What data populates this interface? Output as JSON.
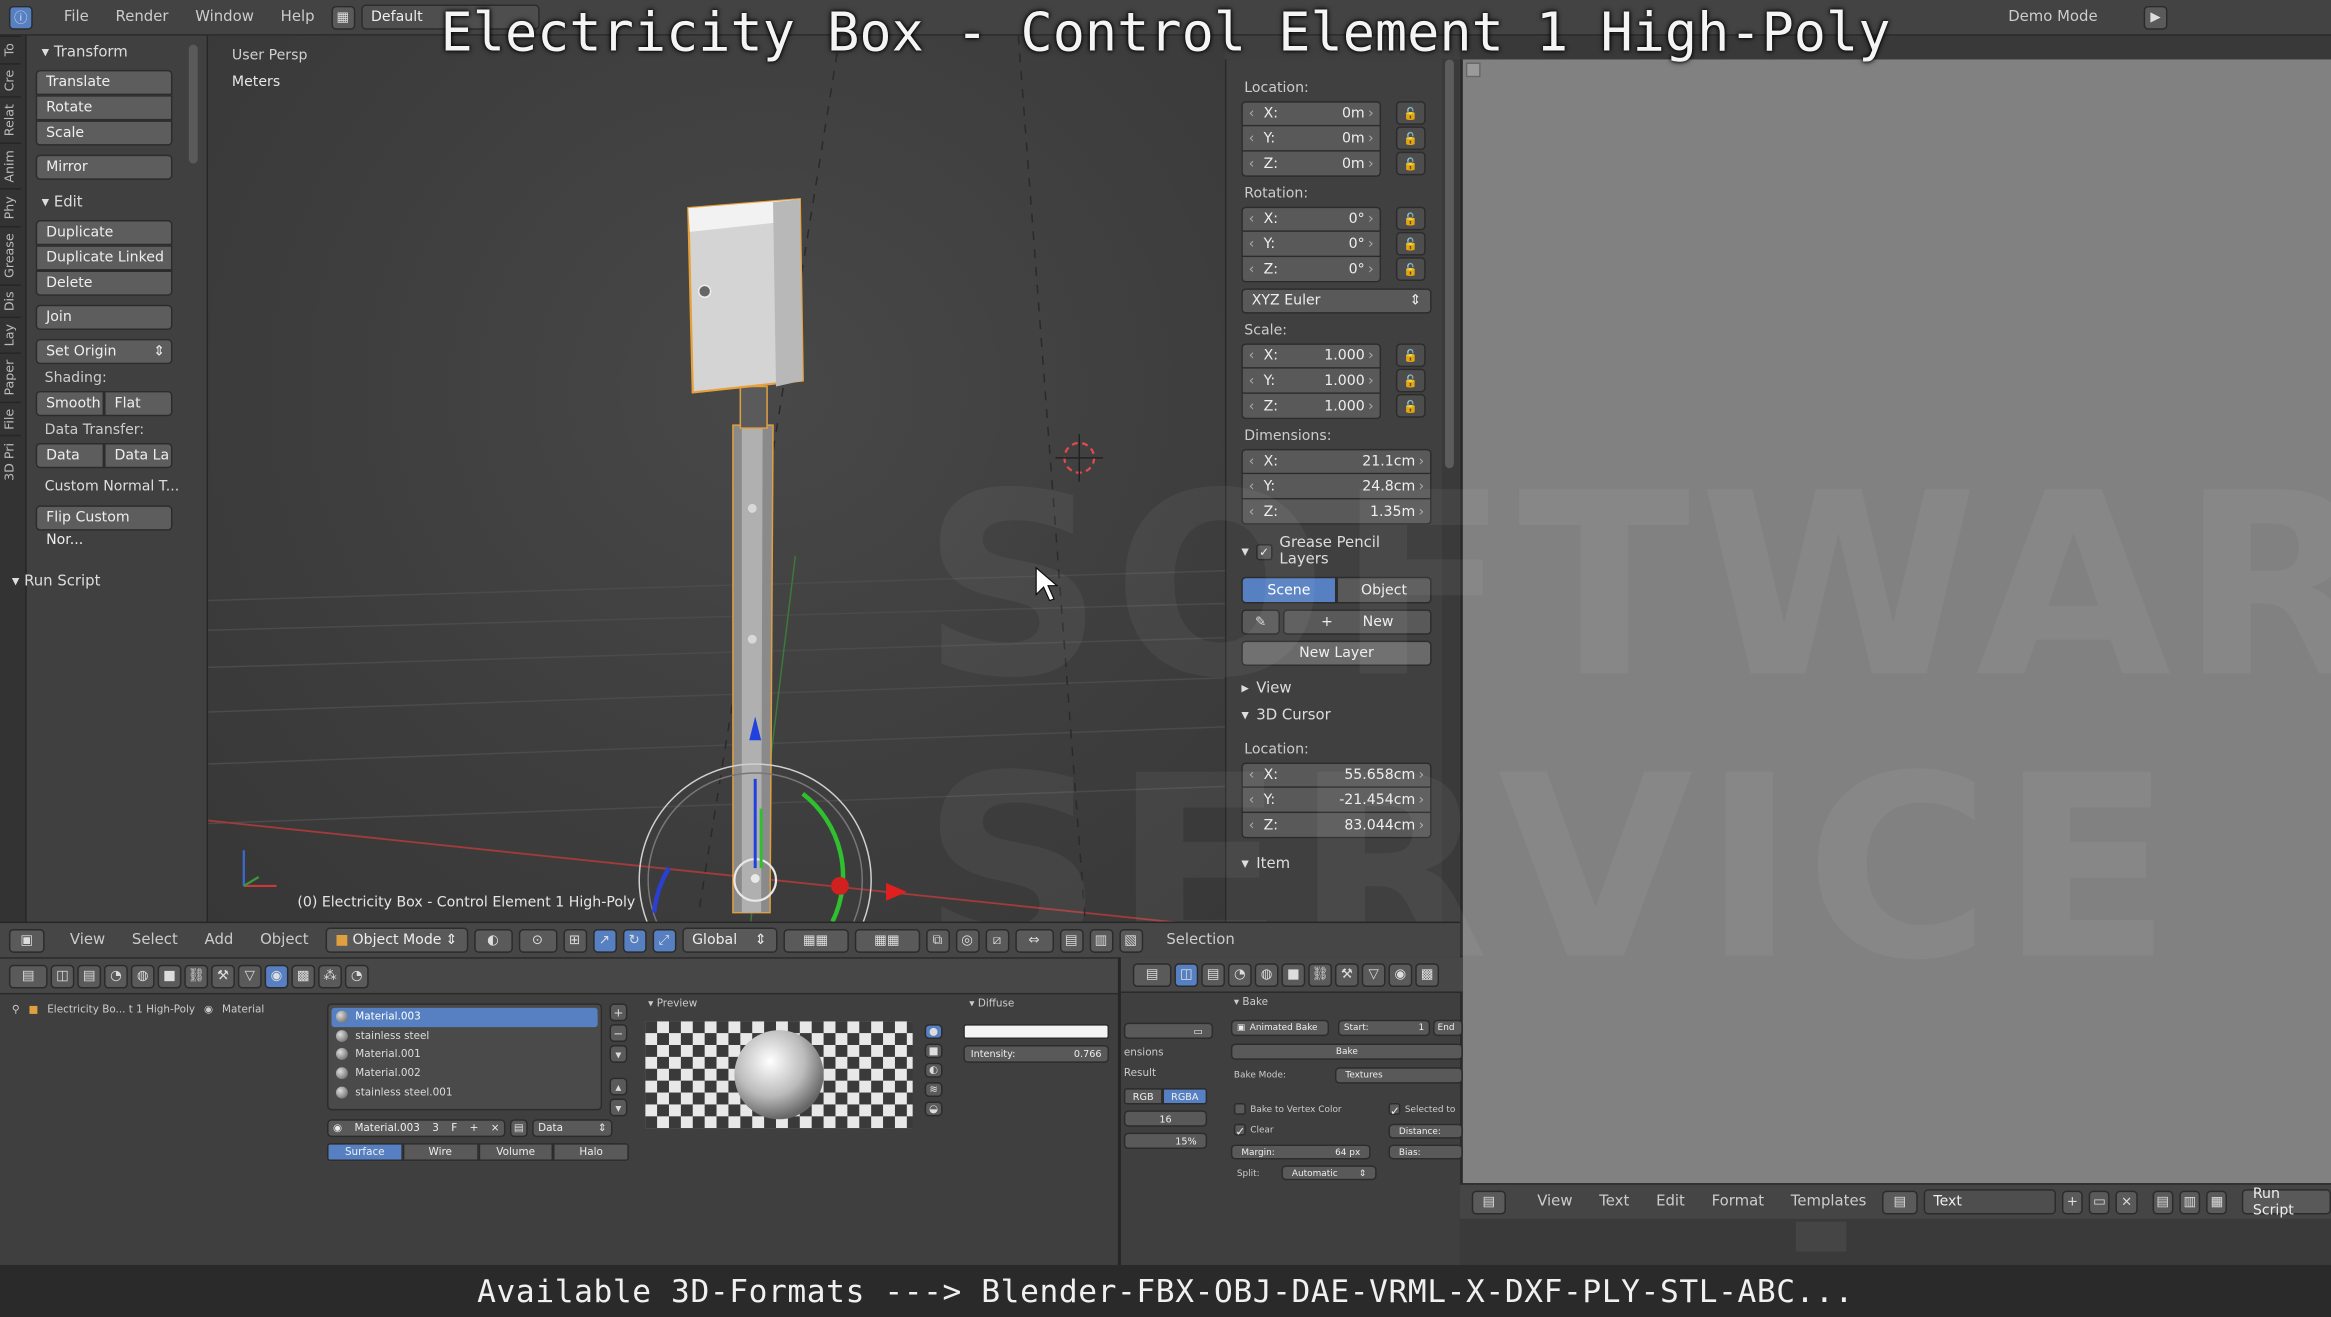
{
  "overlay": {
    "title": "Electricity Box - Control Element 1 High-Poly",
    "caption": "Available 3D-Formats ---> Blender-FBX-OBJ-DAE-VRML-X-DXF-PLY-STL-ABC..."
  },
  "info_header": {
    "menus": [
      "File",
      "Render",
      "Window",
      "Help"
    ],
    "layout": "Default",
    "demo": "Demo Mode"
  },
  "tool_tabs": [
    "To",
    "Cre",
    "Relat",
    "Anim",
    "Phy",
    "Grease",
    "Dis",
    "Lay",
    "Paper",
    "File",
    "3D Pri"
  ],
  "tool_shelf": {
    "transform_header": "Transform",
    "translate": "Translate",
    "rotate": "Rotate",
    "scale": "Scale",
    "mirror": "Mirror",
    "edit_header": "Edit",
    "duplicate": "Duplicate",
    "duplicate_linked": "Duplicate Linked",
    "delete": "Delete",
    "join": "Join",
    "set_origin": "Set Origin",
    "shading_label": "Shading:",
    "smooth": "Smooth",
    "flat": "Flat",
    "data_transfer_label": "Data Transfer:",
    "data": "Data",
    "data_la": "Data La",
    "custom_normal": "Custom Normal T...",
    "flip_custom": "Flip Custom Nor...",
    "run_script_header": "Run Script"
  },
  "viewport": {
    "view_name": "User Persp",
    "units": "Meters",
    "object_info": "(0) Electricity Box - Control Element 1 High-Poly"
  },
  "n_panel": {
    "location_label": "Location:",
    "location": [
      {
        "axis": "X:",
        "value": "0m"
      },
      {
        "axis": "Y:",
        "value": "0m"
      },
      {
        "axis": "Z:",
        "value": "0m"
      }
    ],
    "rotation_label": "Rotation:",
    "rotation": [
      {
        "axis": "X:",
        "value": "0°"
      },
      {
        "axis": "Y:",
        "value": "0°"
      },
      {
        "axis": "Z:",
        "value": "0°"
      }
    ],
    "rotation_mode": "XYZ Euler",
    "scale_label": "Scale:",
    "scale": [
      {
        "axis": "X:",
        "value": "1.000"
      },
      {
        "axis": "Y:",
        "value": "1.000"
      },
      {
        "axis": "Z:",
        "value": "1.000"
      }
    ],
    "dimensions_label": "Dimensions:",
    "dimensions": [
      {
        "axis": "X:",
        "value": "21.1cm"
      },
      {
        "axis": "Y:",
        "value": "24.8cm"
      },
      {
        "axis": "Z:",
        "value": "1.35m"
      }
    ],
    "grease_pencil_header": "Grease Pencil Layers",
    "scene": "Scene",
    "object": "Object",
    "new": "New",
    "new_layer": "New Layer",
    "view_header": "View",
    "cursor_header": "3D Cursor",
    "cursor_location_label": "Location:",
    "cursor": [
      {
        "axis": "X:",
        "value": "55.658cm"
      },
      {
        "axis": "Y:",
        "value": "-21.454cm"
      },
      {
        "axis": "Z:",
        "value": "83.044cm"
      }
    ],
    "item_header": "Item"
  },
  "vp_header": {
    "menus": [
      "View",
      "Select",
      "Add",
      "Object"
    ],
    "mode": "Object Mode",
    "orientation": "Global",
    "selection": "Selection"
  },
  "properties": {
    "breadcrumb": "Electricity Bo... t 1 High-Poly",
    "breadcrumb_material": "Material",
    "materials": [
      "Material.003",
      "stainless steel",
      "Material.001",
      "Material.002",
      "stainless steel.001"
    ],
    "material_field": "Material.003",
    "users": "3",
    "link": "Data",
    "tabs": [
      "Surface",
      "Wire",
      "Volume",
      "Halo"
    ],
    "preview_header": "Preview",
    "diffuse_header": "Diffuse",
    "intensity_label": "Intensity:",
    "intensity_value": "0.766"
  },
  "bake": {
    "header": "Bake",
    "animated_bake": "Animated Bake",
    "start_label": "Start:",
    "start_value": "1",
    "end_label": "End",
    "bake_button": "Bake",
    "bake_mode_label": "Bake Mode:",
    "bake_mode": "Textures",
    "to_vertex": "Bake to Vertex Color",
    "selected": "Selected to",
    "clear": "Clear",
    "distance": "Distance:",
    "margin": "Margin:",
    "margin_value": "64 px",
    "bias": "Bias:",
    "split": "Split:",
    "split_value": "Automatic",
    "ensions": "ensions",
    "result": "Result",
    "rgb": "RGB",
    "rgba": "RGBA",
    "val16": "16",
    "val15": "15%"
  },
  "text_editor": {
    "menus": [
      "View",
      "Text",
      "Edit",
      "Format",
      "Templates"
    ],
    "text_name": "Text",
    "run_script": "Run Script"
  },
  "watermark": [
    "SOFT",
    "WARE",
    "SER",
    "VICE"
  ]
}
